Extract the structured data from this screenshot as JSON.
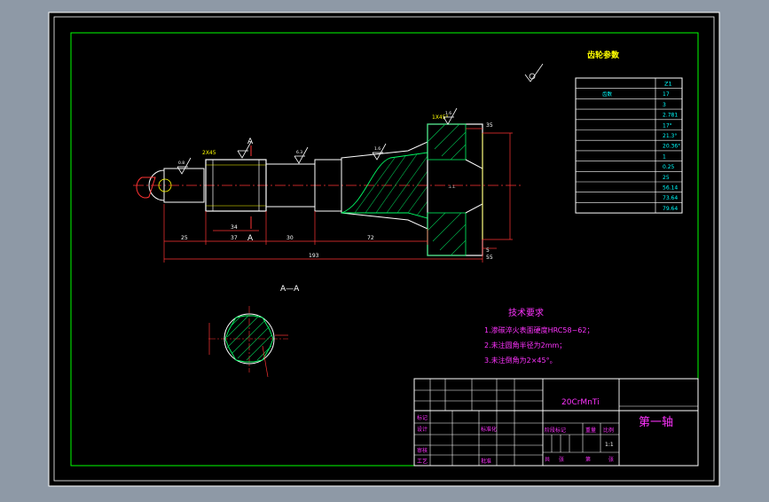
{
  "title": {
    "main": "齿轮参数",
    "sub": "表"
  },
  "params": {
    "header": "Z1",
    "rows": [
      {
        "label": "齿数",
        "value": "17"
      },
      {
        "label": "",
        "value": "3"
      },
      {
        "label": "",
        "value": "2.781"
      },
      {
        "label": "",
        "value": "17°"
      },
      {
        "label": "",
        "value": "21.3°"
      },
      {
        "label": "",
        "value": "20.36°"
      },
      {
        "label": "",
        "value": "1"
      },
      {
        "label": "",
        "value": "0.25"
      },
      {
        "label": "",
        "value": "25"
      },
      {
        "label": "",
        "value": "56.14"
      },
      {
        "label": "",
        "value": "73.64"
      },
      {
        "label": "",
        "value": "79.64"
      }
    ]
  },
  "dims": {
    "chamfer": "1X45°",
    "chamfer_left": "2X45",
    "len_25": "25",
    "len_37": "37",
    "len_34": "34",
    "len_30": "30",
    "len_72": "72",
    "len_total": "193",
    "len_35": "35",
    "len_5": "5",
    "len_55": "55",
    "ra_16": "1.6",
    "ra_08": "0.8",
    "ra_63": "6.3"
  },
  "section": {
    "marker": "A",
    "label": "A—A"
  },
  "tech": {
    "title": "技术要求",
    "lines": [
      "1.渗碳淬火表面硬度HRC58~62；",
      "2.未注圆角半径为2mm；",
      "3.未注倒角为2×45°。"
    ]
  },
  "titleblock": {
    "material": "20CrMnTi",
    "partname": "第一轴",
    "scale": "1:1",
    "labels": {
      "mark": "标记",
      "design": "设计",
      "review": "审核",
      "process": "工艺",
      "standard": "标准化",
      "approve": "批准",
      "stage": "阶段标记",
      "weight": "重量",
      "ratio": "比例",
      "sheet_total": "共",
      "sheet_no": "第",
      "sheets": "张"
    }
  }
}
